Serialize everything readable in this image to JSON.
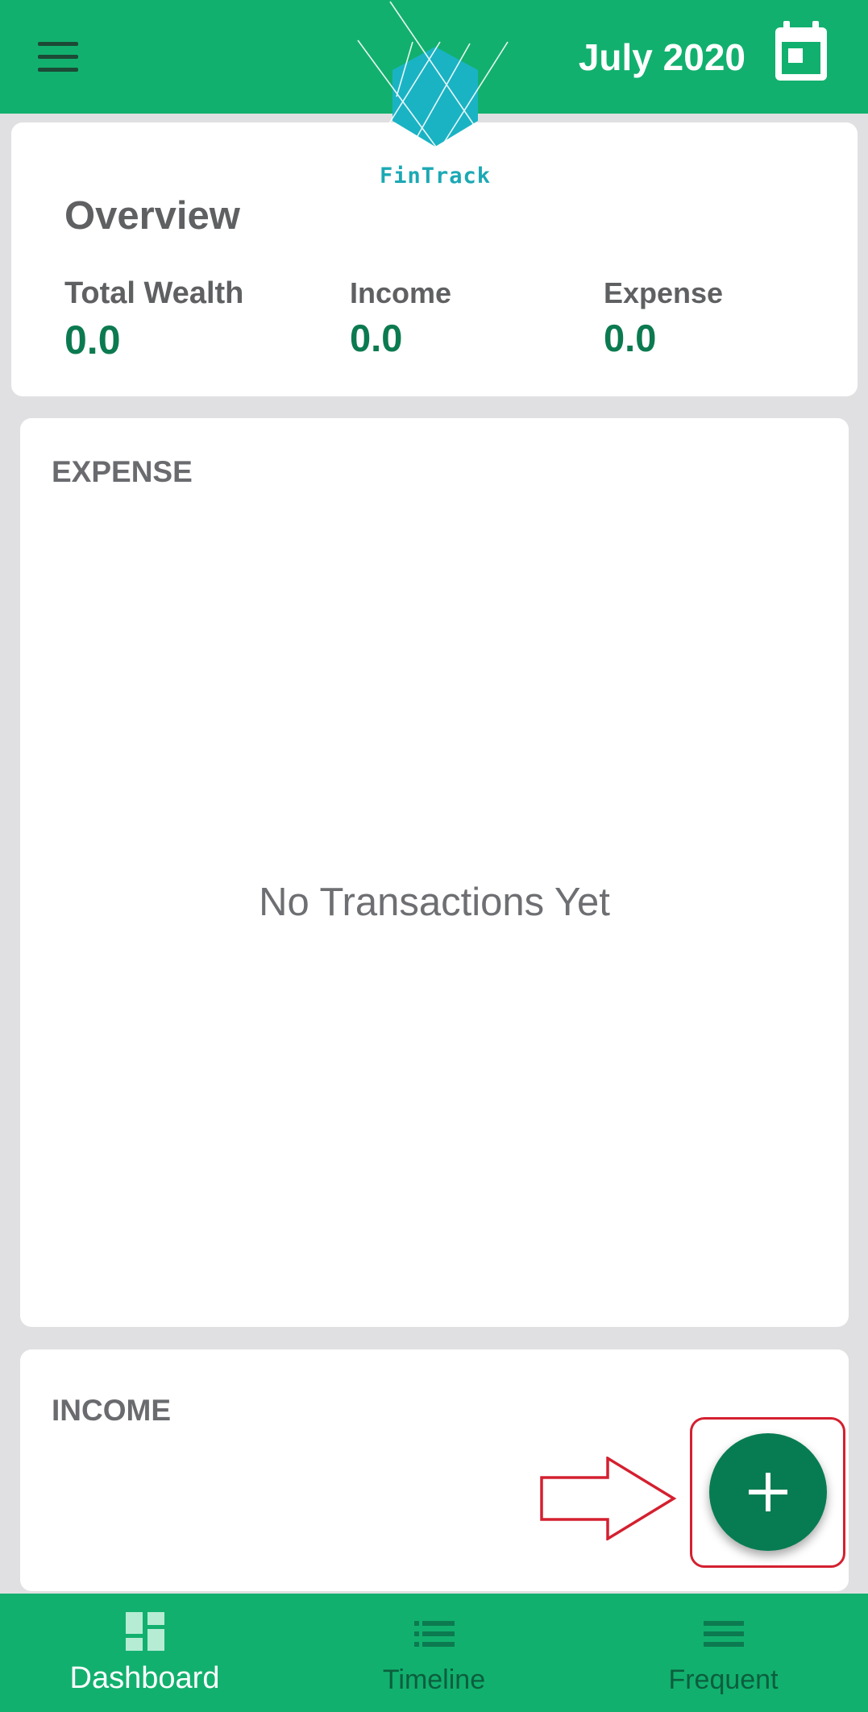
{
  "app": {
    "logo_text": "FinTrack"
  },
  "header": {
    "menu_icon": "hamburger-menu-icon",
    "month_label": "July 2020",
    "calendar_icon": "calendar-icon"
  },
  "overview": {
    "title": "Overview",
    "stats": [
      {
        "label": "Total Wealth",
        "value": "0.0"
      },
      {
        "label": "Income",
        "value": "0.0"
      },
      {
        "label": "Expense",
        "value": "0.0"
      }
    ]
  },
  "expense_section": {
    "title": "EXPENSE",
    "empty_text": "No Transactions Yet"
  },
  "income_section": {
    "title": "INCOME"
  },
  "fab": {
    "icon": "plus-icon"
  },
  "bottom_nav": {
    "items": [
      {
        "label": "Dashboard",
        "icon": "dashboard-icon",
        "active": true
      },
      {
        "label": "Timeline",
        "icon": "list-icon",
        "active": false
      },
      {
        "label": "Frequent",
        "icon": "menu-lines-icon",
        "active": false
      }
    ]
  },
  "colors": {
    "primary": "#12b06e",
    "primary_dark": "#077c52",
    "value_green": "#0c7a50",
    "annotation_red": "#d42030",
    "logo_teal": "#1ba9b4"
  }
}
